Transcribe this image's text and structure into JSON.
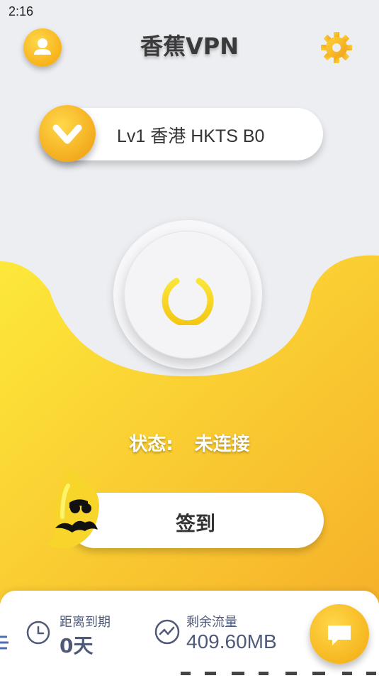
{
  "status_bar": {
    "time": "2:16"
  },
  "header": {
    "title": "香蕉VPN",
    "avatar_icon": "user-icon",
    "settings_icon": "gear-icon"
  },
  "server_selector": {
    "label": "Lv1 香港 HKTS B0",
    "icon": "chevron-down-icon"
  },
  "power": {
    "icon": "power-icon"
  },
  "connection": {
    "status_label": "状态:",
    "status_value": "未连接"
  },
  "checkin": {
    "label": "签到"
  },
  "stats": {
    "expiry_label": "距离到期",
    "expiry_value": "0天",
    "traffic_label": "剩余流量",
    "traffic_value": "409.60MB"
  },
  "chat": {
    "icon": "chat-icon"
  },
  "colors": {
    "accent": "#f7b31c",
    "yellow_light": "#fde03a",
    "background": "#eceef2",
    "stat_text": "#4f5a79"
  }
}
